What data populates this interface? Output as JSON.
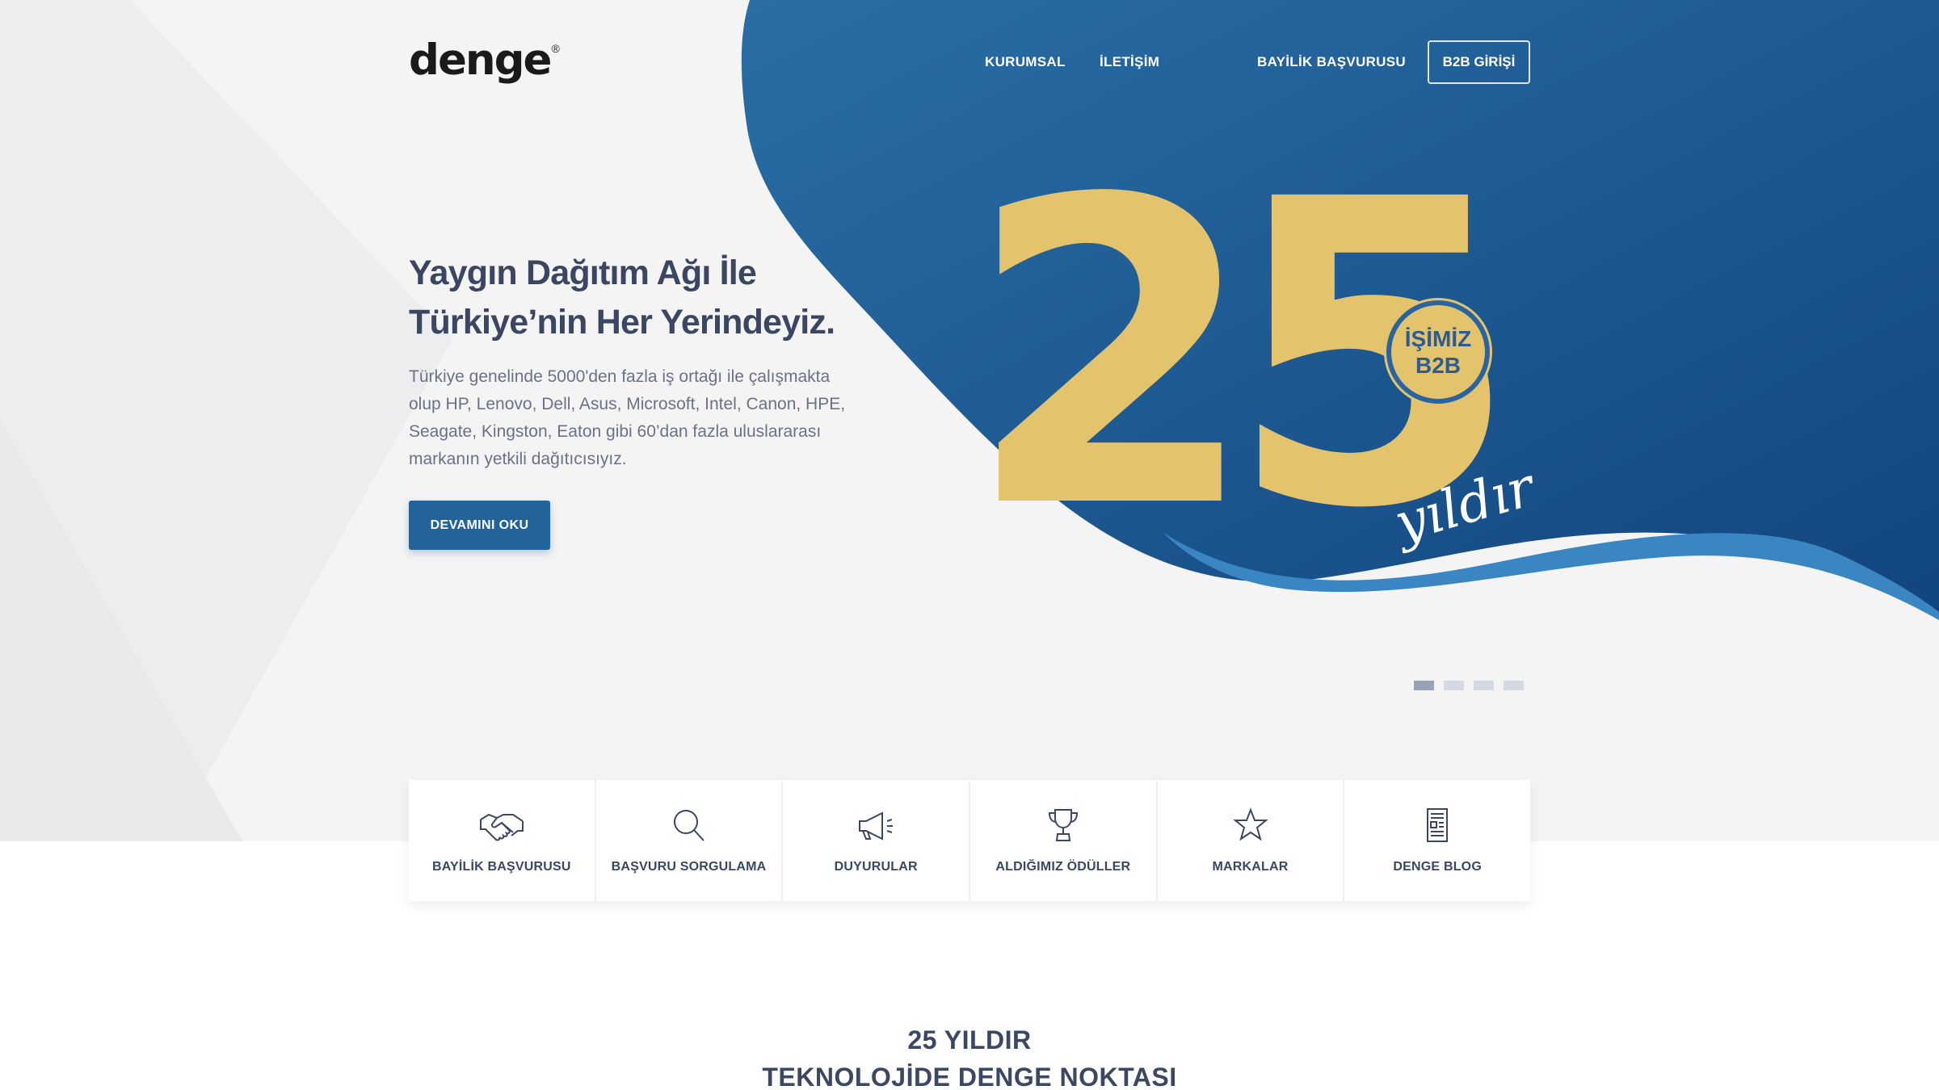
{
  "brand": {
    "logo_text": "denge",
    "logo_mark": "®"
  },
  "nav": {
    "items": [
      "KURUMSAL",
      "İLETİŞİM",
      "BAYİLİK BAŞVURUSU"
    ],
    "b2b_label": "B2B GİRİŞİ"
  },
  "hero": {
    "title_lines": [
      "Yaygın Dağıtım Ağı İle",
      "Türkiye’nin Her Yerindeyiz."
    ],
    "description_lines": [
      "Türkiye genelinde 5000'den fazla iş ortağı ile çalışmakta",
      "olup HP, Lenovo, Dell, Asus, Microsoft, Intel, Canon, HPE,",
      "Seagate, Kingston, Eaton gibi 60’dan fazla uluslararası",
      "markanın yetkili dağıtıcısıyız."
    ],
    "cta_label": "DEVAMINI OKU",
    "artwork": {
      "number": "25",
      "badge_lines": [
        "İŞİMİZ",
        "B2B"
      ],
      "script_text": "yıldır"
    },
    "slider": {
      "count": 4,
      "active_index": 0
    }
  },
  "colors": {
    "primary_blue": "#226499",
    "dark_blue": "#134a82",
    "gold": "#e3c46d",
    "text": "#3c4763",
    "muted": "#6b7186"
  },
  "quick_links": [
    {
      "label": "BAYİLİK BAŞVURUSU",
      "icon": "handshake-icon"
    },
    {
      "label": "BAŞVURU SORGULAMA",
      "icon": "search-icon"
    },
    {
      "label": "DUYURULAR",
      "icon": "megaphone-icon"
    },
    {
      "label": "ALDIĞIMIZ ÖDÜLLER",
      "icon": "trophy-icon"
    },
    {
      "label": "MARKALAR",
      "icon": "star-icon"
    },
    {
      "label": "DENGE BLOG",
      "icon": "document-icon"
    }
  ],
  "section": {
    "title_lines": [
      "25 YILDIR",
      "TEKNOLOJİDE DENGE NOKTASI"
    ]
  }
}
